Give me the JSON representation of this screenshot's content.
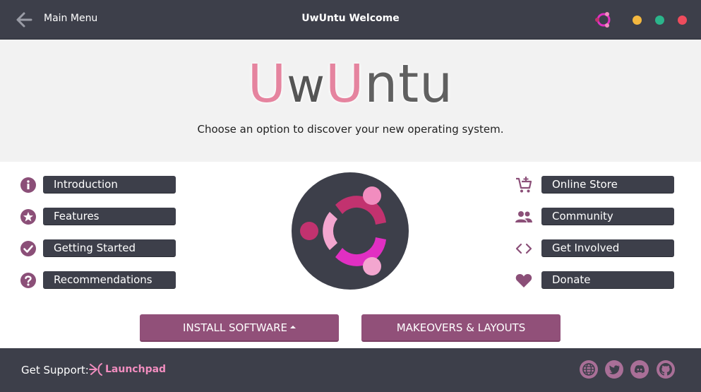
{
  "titlebar": {
    "back_label": "Main Menu",
    "title": "UwUntu Welcome"
  },
  "header": {
    "brand_parts": [
      "U",
      "w",
      "U",
      "ntu"
    ],
    "tagline": "Choose an option to discover your new operating system."
  },
  "left_menu": [
    {
      "label": "Introduction",
      "icon": "info-icon"
    },
    {
      "label": "Features",
      "icon": "star-icon"
    },
    {
      "label": "Getting Started",
      "icon": "checkmark-icon"
    },
    {
      "label": "Recommendations",
      "icon": "question-icon"
    }
  ],
  "right_menu": [
    {
      "label": "Online Store",
      "icon": "cart-icon"
    },
    {
      "label": "Community",
      "icon": "people-icon"
    },
    {
      "label": "Get Involved",
      "icon": "code-icon"
    },
    {
      "label": "Donate",
      "icon": "heart-icon"
    }
  ],
  "actions": {
    "install_label": "INSTALL SOFTWARE",
    "makeovers_label": "MAKEOVERS & LAYOUTS"
  },
  "footer": {
    "support_label": "Get Support:",
    "launchpad_label": "Launchpad",
    "social": [
      "globe-icon",
      "twitter-icon",
      "discord-icon",
      "github-icon"
    ]
  },
  "colors": {
    "dark": "#3d3f4a",
    "accent": "#915079",
    "pink": "#f18dbf",
    "magenta": "#e12fc2",
    "icon": "#8b4f78"
  }
}
